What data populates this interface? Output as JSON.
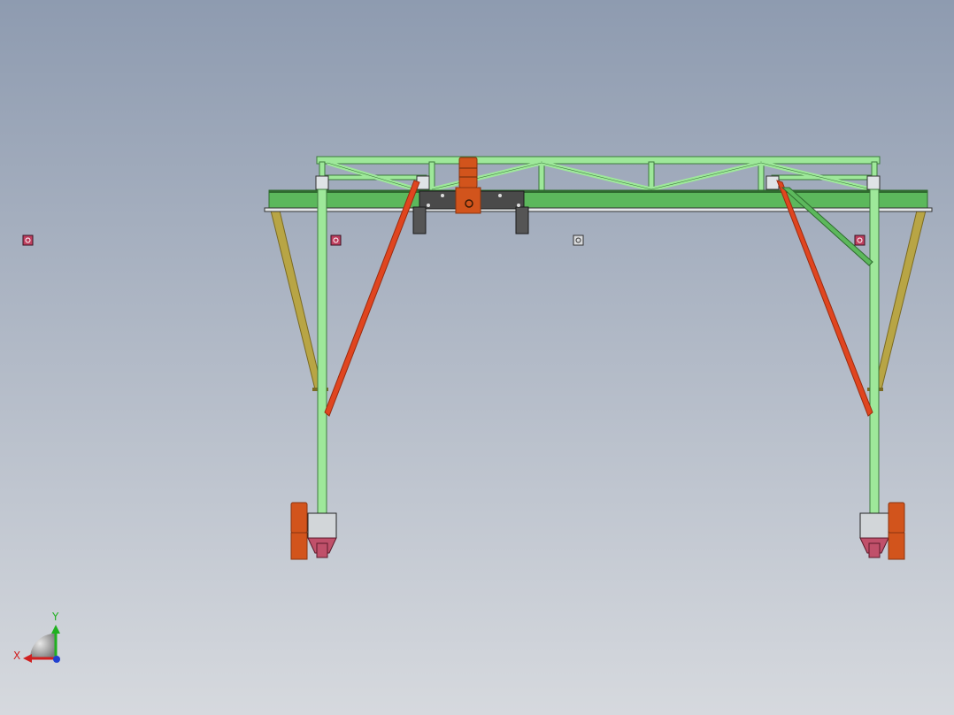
{
  "viewport": {
    "background_top": "#8e9bb0",
    "background_bottom": "#d6d9de"
  },
  "model": {
    "name": "gantry-crane",
    "colors": {
      "truss_green": "#9ee89a",
      "truss_stroke": "#3d7a3d",
      "beam_green": "#5cb85c",
      "beam_dark": "#2f6b2f",
      "brace_red": "#e0451f",
      "brace_red_dark": "#9a2c10",
      "strut_olive": "#b8a545",
      "strut_olive_dark": "#7a6a22",
      "trolley_gray": "#4a4a4a",
      "motor_orange": "#d2541c",
      "motor_orange_dark": "#8a3410",
      "wheel_magenta": "#c0506a",
      "housing_gray": "#c8ccd0",
      "marker_magenta": "#c04060"
    }
  },
  "triad": {
    "x_label": "X",
    "y_label": "Y",
    "x_color": "#d02020",
    "y_color": "#20b020",
    "z_color": "#2040d0"
  }
}
